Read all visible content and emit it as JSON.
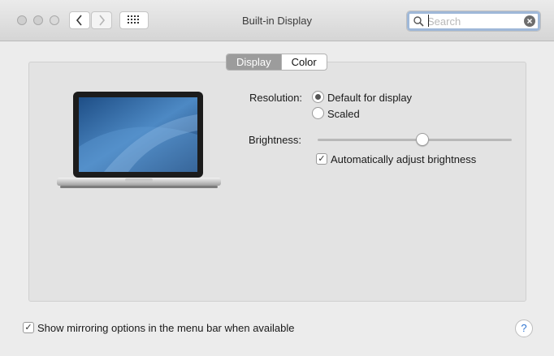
{
  "window": {
    "title": "Built-in Display"
  },
  "toolbar": {
    "back_icon": "chevron-left-icon",
    "forward_icon": "chevron-right-icon",
    "grid_icon": "grid-icon"
  },
  "search": {
    "placeholder": "Search",
    "value": ""
  },
  "tabs": [
    {
      "label": "Display",
      "selected": true
    },
    {
      "label": "Color",
      "selected": false
    }
  ],
  "resolution": {
    "label": "Resolution:",
    "options": [
      {
        "label": "Default for display",
        "selected": true
      },
      {
        "label": "Scaled",
        "selected": false
      }
    ]
  },
  "brightness": {
    "label": "Brightness:",
    "value": 0.54,
    "auto_adjust": {
      "label": "Automatically adjust brightness",
      "checked": true
    }
  },
  "footer": {
    "mirroring": {
      "label": "Show mirroring options in the menu bar when available",
      "checked": true
    },
    "help_label": "?"
  },
  "colors": {
    "accent": "#2f74d0",
    "panel": "#e3e3e3",
    "window": "#ececec"
  }
}
